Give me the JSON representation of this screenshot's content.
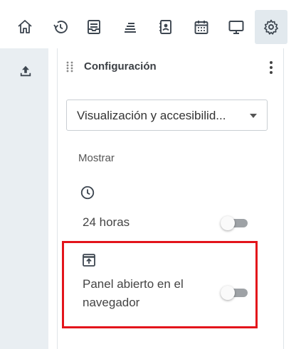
{
  "toolbar": {
    "buttons": [
      {
        "icon": "home-icon"
      },
      {
        "icon": "history-icon"
      },
      {
        "icon": "inbox-icon"
      },
      {
        "icon": "stack-icon"
      },
      {
        "icon": "contacts-icon"
      },
      {
        "icon": "calendar-icon"
      },
      {
        "icon": "monitor-icon"
      },
      {
        "icon": "gear-icon",
        "active": true
      }
    ]
  },
  "rail": {
    "upload_icon": "upload-icon"
  },
  "panel": {
    "title": "Configuración",
    "dropdown": {
      "selected": "Visualización y accesibilid..."
    },
    "section_label": "Mostrar",
    "settings": [
      {
        "icon": "clock-icon",
        "label": "24 horas",
        "enabled": false
      },
      {
        "icon": "open-panel-icon",
        "label": "Panel abierto en el navegador",
        "enabled": false
      }
    ]
  },
  "colors": {
    "highlight": "#e3141b",
    "icon": "#3d4650",
    "active_bg": "#e2e9ee",
    "rail_bg": "#e9eef2",
    "toggle_track": "#9ea2a6"
  }
}
